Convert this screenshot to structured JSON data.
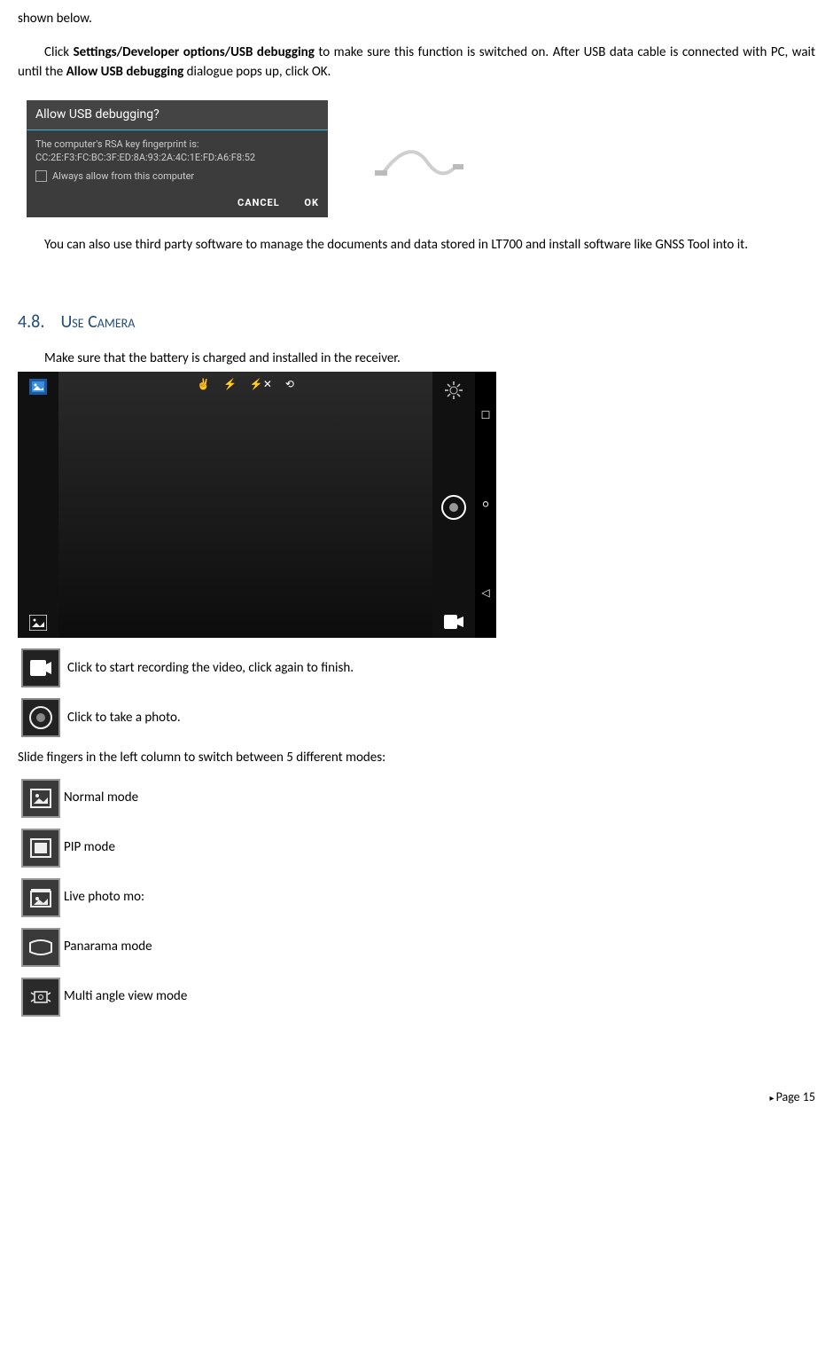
{
  "top_text": "shown below.",
  "para1_a": "Click",
  "para1_b": "Settings/Developer options/USB debugging",
  "para1_c": "to make sure this function is switched on. After USB data cable is connected with PC, wait until the",
  "para1_d": "Allow USB debugging",
  "para1_e": "dialogue pops up, click OK.",
  "dlg": {
    "title": "Allow USB debugging?",
    "body_1": "The computer's RSA key fingerprint is:",
    "body_2": "CC:2E:F3:FC:BC:3F:ED:8A:93:2A:4C:1E:FD:A6:F8:52",
    "checkbox_label": "Always allow from this computer",
    "btn_cancel": "CANCEL",
    "btn_ok": "OK"
  },
  "para2": "You can also use third party software to manage the documents and data stored in LT700 and install software like GNSS Tool into it.",
  "section": {
    "number": "4.8.",
    "title": "Use Camera"
  },
  "camera_intro": "Make sure that the battery is charged and installed in the receiver.",
  "desc_video": "Click to start recording the video, click again to finish.",
  "desc_photo": "Click to take a photo.",
  "desc_slide": "Slide fingers in the left column to switch between 5 different modes:",
  "mode_normal": "Normal mode",
  "mode_pip": "PIP mode",
  "mode_live": "Live photo mo:",
  "mode_pano": "Panarama mode",
  "mode_multi": "Multi angle view mode",
  "footer": "Page 15"
}
